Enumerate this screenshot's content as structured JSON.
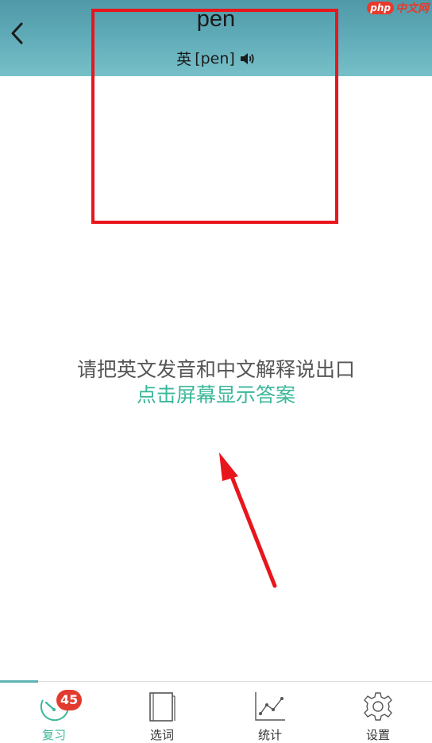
{
  "header": {
    "word": "pen",
    "phonetic_label": "英",
    "phonetic": "[pen]",
    "back_icon": "chevron-left-icon",
    "speaker_icon": "speaker-icon"
  },
  "watermark": {
    "php": "php",
    "site": "中文网"
  },
  "main": {
    "prompt": "请把英文发音和中文解释说出口",
    "reveal": "点击屏幕显示答案"
  },
  "tabs": [
    {
      "label": "复习",
      "icon": "timer-icon",
      "badge": "45",
      "active": true
    },
    {
      "label": "选词",
      "icon": "book-icon",
      "active": false
    },
    {
      "label": "统计",
      "icon": "line-chart-icon",
      "active": false
    },
    {
      "label": "设置",
      "icon": "gear-icon",
      "active": false
    }
  ],
  "colors": {
    "header": "#5ea9b5",
    "accent": "#3ab79a",
    "annotation": "#e8161c",
    "badge": "#e23a2e"
  }
}
